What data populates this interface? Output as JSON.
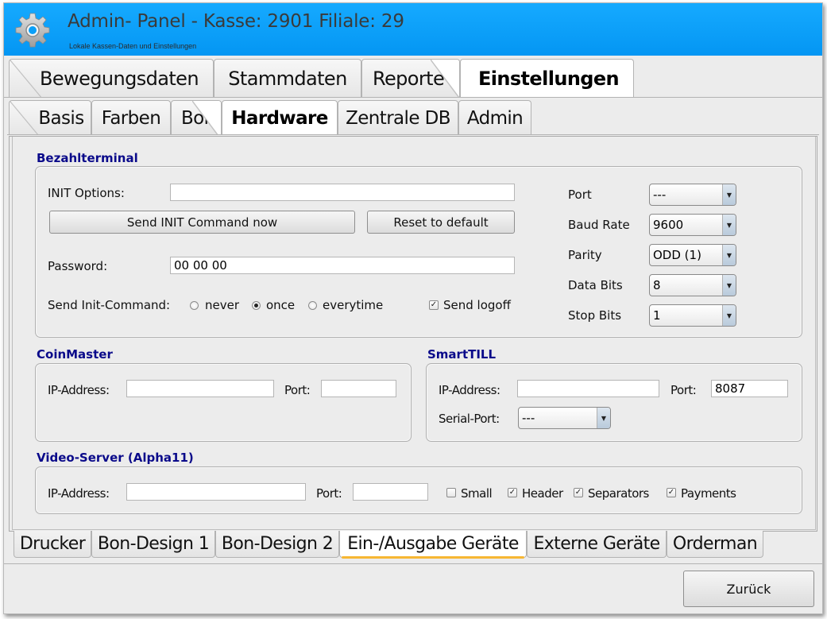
{
  "header": {
    "title": "Admin- Panel - Kasse: 2901 Filiale: 29",
    "subtitle": "Lokale Kassen-Daten und Einstellungen",
    "icon": "gear-icon",
    "accent": "#0a9ff8"
  },
  "main_tabs": [
    {
      "label": "Bewegungsdaten",
      "active": false
    },
    {
      "label": "Stammdaten",
      "active": false
    },
    {
      "label": "Reporte",
      "active": false
    },
    {
      "label": "Einstellungen",
      "active": true
    }
  ],
  "sub_tabs": [
    {
      "label": "Basis",
      "active": false
    },
    {
      "label": "Farben",
      "active": false
    },
    {
      "label": "Bon",
      "active": false
    },
    {
      "label": "Hardware",
      "active": true
    },
    {
      "label": "Zentrale DB",
      "active": false
    },
    {
      "label": "Admin",
      "active": false
    }
  ],
  "bezahlterminal": {
    "title": "Bezahlterminal",
    "init_options_label": "INIT Options:",
    "init_options_value": "",
    "send_init_button": "Send INIT Command now",
    "reset_button": "Reset to default",
    "password_label": "Password:",
    "password_value": "00 00 00",
    "send_init_label": "Send Init-Command:",
    "radio_options": [
      {
        "label": "never",
        "checked": false
      },
      {
        "label": "once",
        "checked": true
      },
      {
        "label": "everytime",
        "checked": false
      }
    ],
    "send_logoff_label": "Send logoff",
    "send_logoff_checked": true,
    "serial": [
      {
        "label": "Port",
        "value": "---"
      },
      {
        "label": "Baud Rate",
        "value": "9600"
      },
      {
        "label": "Parity",
        "value": "ODD (1)"
      },
      {
        "label": "Data Bits",
        "value": "8"
      },
      {
        "label": "Stop Bits",
        "value": "1"
      }
    ]
  },
  "coinmaster": {
    "title": "CoinMaster",
    "ip_label": "IP-Address:",
    "ip_value": "",
    "port_label": "Port:",
    "port_value": ""
  },
  "smarttill": {
    "title": "SmartTILL",
    "ip_label": "IP-Address:",
    "ip_value": "",
    "port_label": "Port:",
    "port_value": "8087",
    "serial_label": "Serial-Port:",
    "serial_value": "---"
  },
  "videoserver": {
    "title": "Video-Server (Alpha11)",
    "ip_label": "IP-Address:",
    "ip_value": "",
    "port_label": "Port:",
    "port_value": "",
    "checkboxes": [
      {
        "label": "Small",
        "checked": false
      },
      {
        "label": "Header",
        "checked": true
      },
      {
        "label": "Separators",
        "checked": true
      },
      {
        "label": "Payments",
        "checked": true
      }
    ]
  },
  "bottom_tabs": [
    {
      "label": "Drucker",
      "active": false
    },
    {
      "label": "Bon-Design 1",
      "active": false
    },
    {
      "label": "Bon-Design 2",
      "active": false
    },
    {
      "label": "Ein-/Ausgabe Geräte",
      "active": true
    },
    {
      "label": "Externe Geräte",
      "active": false
    },
    {
      "label": "Orderman",
      "active": false
    }
  ],
  "footer": {
    "back_button": "Zurück"
  },
  "glyphs": {
    "check": "✓",
    "arrow": "▼"
  }
}
